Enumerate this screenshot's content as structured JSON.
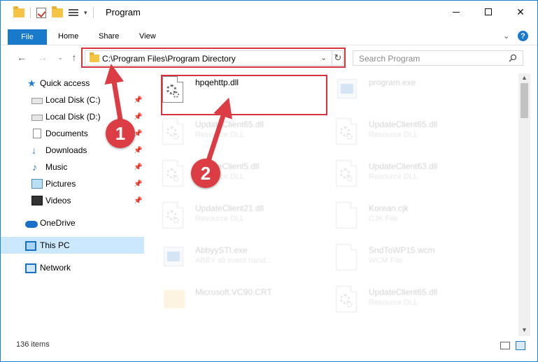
{
  "window": {
    "title": "Program",
    "minimize_glyph": "",
    "maximize_glyph": "",
    "close_glyph": "✕"
  },
  "ribbon": {
    "file": "File",
    "home": "Home",
    "share": "Share",
    "view": "View",
    "expand_glyph": "⌄",
    "help_glyph": "?"
  },
  "nav": {
    "back_glyph": "←",
    "forward_glyph": "→",
    "recent_glyph": "⌄",
    "up_glyph": "↑",
    "address": "C:\\Program Files\\Program Directory",
    "address_dropdown_glyph": "⌄",
    "refresh_glyph": "↻",
    "search_placeholder": "Search Program"
  },
  "sidebar": {
    "items": [
      {
        "label": "Quick access",
        "icon": "star-icon"
      },
      {
        "label": "Local Disk (C:)",
        "icon": "drive-icon",
        "pinned": true
      },
      {
        "label": "Local Disk (D:)",
        "icon": "drive-icon",
        "pinned": true
      },
      {
        "label": "Documents",
        "icon": "documents-icon",
        "pinned": true
      },
      {
        "label": "Downloads",
        "icon": "download-icon",
        "pinned": true
      },
      {
        "label": "Music",
        "icon": "music-icon",
        "pinned": true
      },
      {
        "label": "Pictures",
        "icon": "pictures-icon",
        "pinned": true
      },
      {
        "label": "Videos",
        "icon": "videos-icon",
        "pinned": true
      },
      {
        "label": "OneDrive",
        "icon": "cloud-icon"
      },
      {
        "label": "This PC",
        "icon": "computer-icon",
        "selected": true
      },
      {
        "label": "Network",
        "icon": "network-icon"
      }
    ]
  },
  "files": [
    {
      "name": "hpqehttp.dll",
      "type": "",
      "icon": "dll-icon",
      "highlighted": true
    },
    {
      "name": "program.exe",
      "type": "",
      "icon": "exe-icon"
    },
    {
      "name": "UpdateClient65.dll",
      "type": "Resource DLL",
      "icon": "dll-icon"
    },
    {
      "name": "UpdateClient65.dll",
      "type": "Resource DLL",
      "icon": "dll-icon"
    },
    {
      "name": "UpdateClient5.dll",
      "type": "Resource DLL",
      "icon": "dll-icon"
    },
    {
      "name": "UpdateClient63.dll",
      "type": "Resource DLL",
      "icon": "dll-icon"
    },
    {
      "name": "UpdateClient21.dll",
      "type": "Resource DLL",
      "icon": "dll-icon"
    },
    {
      "name": "Korean.cjk",
      "type": "CJK File",
      "icon": "file-icon"
    },
    {
      "name": "AbbyySTI.exe",
      "type": "ABBY sti event hand...",
      "icon": "exe-icon"
    },
    {
      "name": "SndToWP15.wcm",
      "type": "WCM File",
      "icon": "file-icon"
    },
    {
      "name": "Microsoft.VC90.CRT",
      "type": "",
      "icon": "folder-icon"
    },
    {
      "name": "UpdateClient65.dll",
      "type": "Resource DLL",
      "icon": "dll-icon"
    }
  ],
  "status": {
    "count": "136 items"
  },
  "annotations": {
    "step1": "1",
    "step2": "2"
  },
  "colors": {
    "accent": "#1979ca",
    "highlight_red": "#d9343e",
    "badge_red": "#dc3c43",
    "selected_bg": "#cce8ff"
  }
}
